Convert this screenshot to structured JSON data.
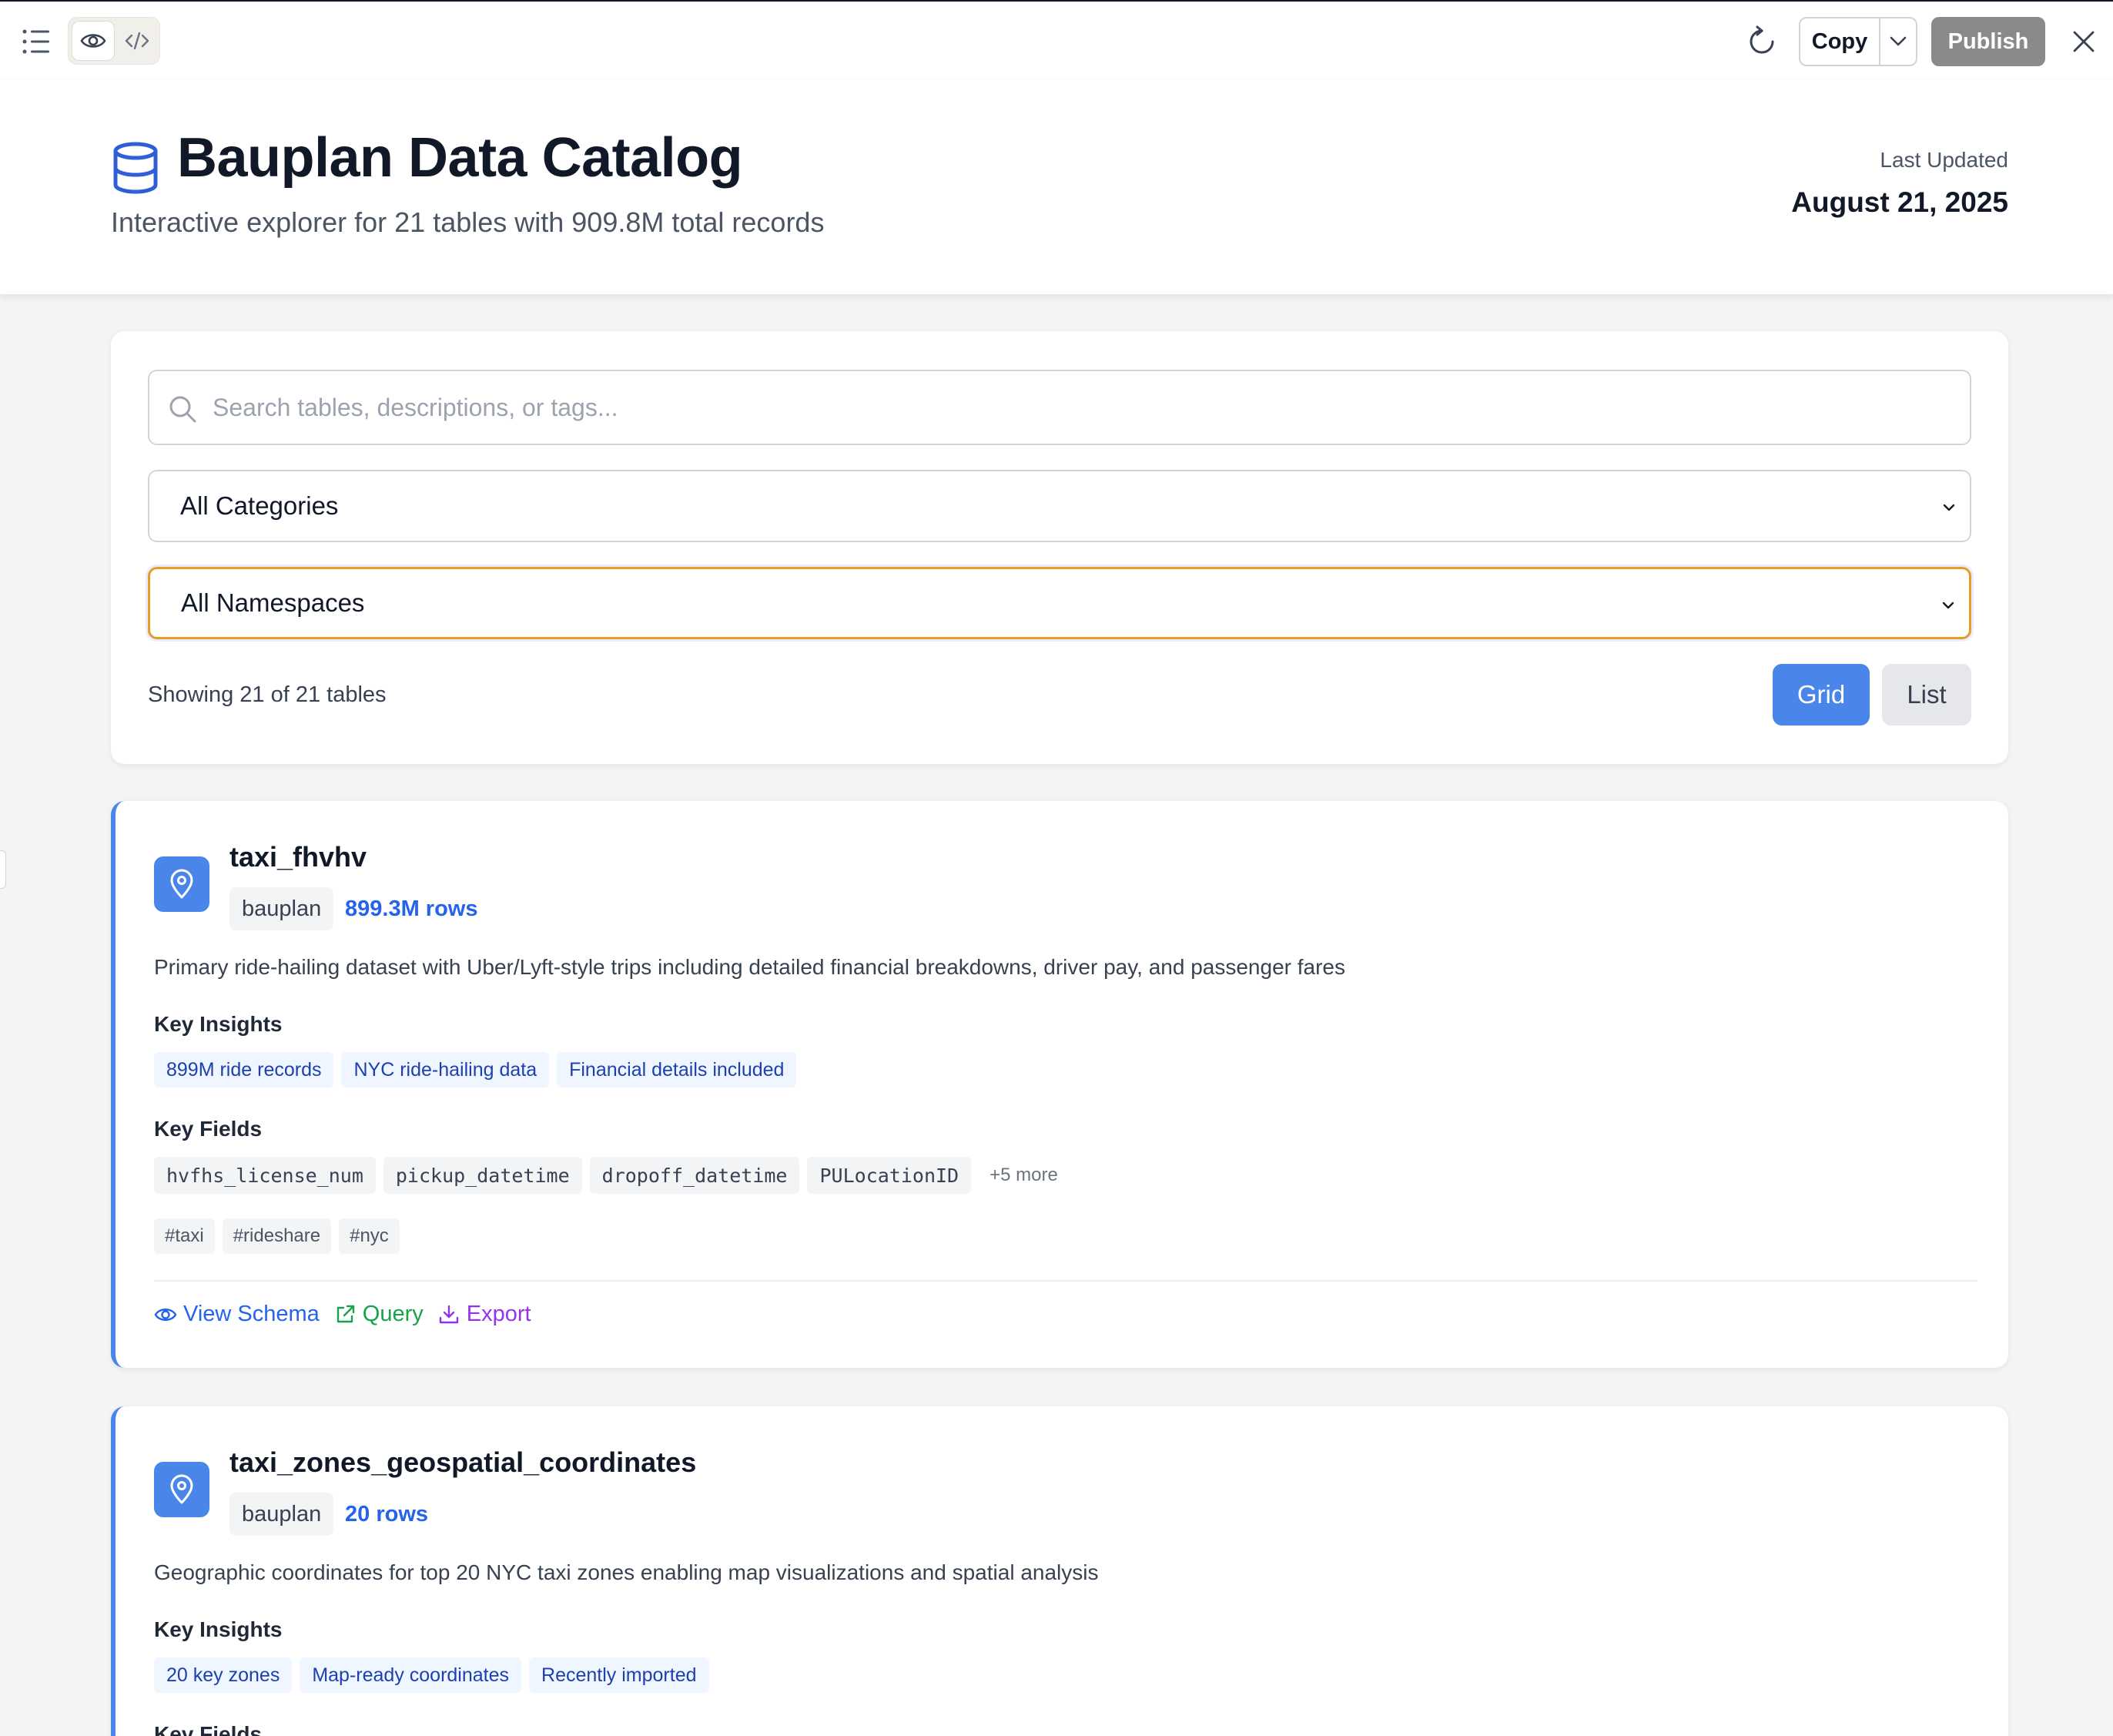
{
  "toolbar": {
    "copy_label": "Copy",
    "publish_label": "Publish",
    "icons": [
      "list-icon",
      "eye-icon",
      "code-icon",
      "refresh-icon",
      "chevron-down-icon",
      "close-icon"
    ]
  },
  "header": {
    "title": "Bauplan Data Catalog",
    "subtitle": "Interactive explorer for 21 tables with 909.8M total records",
    "updated_label": "Last Updated",
    "updated_date": "August 21, 2025"
  },
  "filters": {
    "search_placeholder": "Search tables, descriptions, or tags...",
    "search_value": "",
    "category_selected": "All Categories",
    "namespace_selected": "All Namespaces",
    "result_count": "Showing 21 of 21 tables",
    "view_grid_label": "Grid",
    "view_list_label": "List",
    "active_view": "Grid"
  },
  "tables": [
    {
      "name": "taxi_fhvhv",
      "namespace": "bauplan",
      "rows": "899.3M rows",
      "description": "Primary ride-hailing dataset with Uber/Lyft-style trips including detailed financial breakdowns, driver pay, and passenger fares",
      "insights_label": "Key Insights",
      "insights": [
        "899M ride records",
        "NYC ride-hailing data",
        "Financial details included"
      ],
      "fields_label": "Key Fields",
      "fields": [
        "hvfhs_license_num",
        "pickup_datetime",
        "dropoff_datetime",
        "PULocationID"
      ],
      "more_fields": "+5 more",
      "tags": [
        "#taxi",
        "#rideshare",
        "#nyc"
      ],
      "actions": {
        "schema": "View Schema",
        "query": "Query",
        "export": "Export"
      }
    },
    {
      "name": "taxi_zones_geospatial_coordinates",
      "namespace": "bauplan",
      "rows": "20 rows",
      "description": "Geographic coordinates for top 20 NYC taxi zones enabling map visualizations and spatial analysis",
      "insights_label": "Key Insights",
      "insights": [
        "20 key zones",
        "Map-ready coordinates",
        "Recently imported"
      ],
      "fields_label": "Key Fields"
    }
  ],
  "colors": {
    "accent": "#4a86ea",
    "link_blue": "#2563eb",
    "query_green": "#16a34a",
    "export_purple": "#9333ea",
    "focus_ring": "#e69b2a"
  }
}
